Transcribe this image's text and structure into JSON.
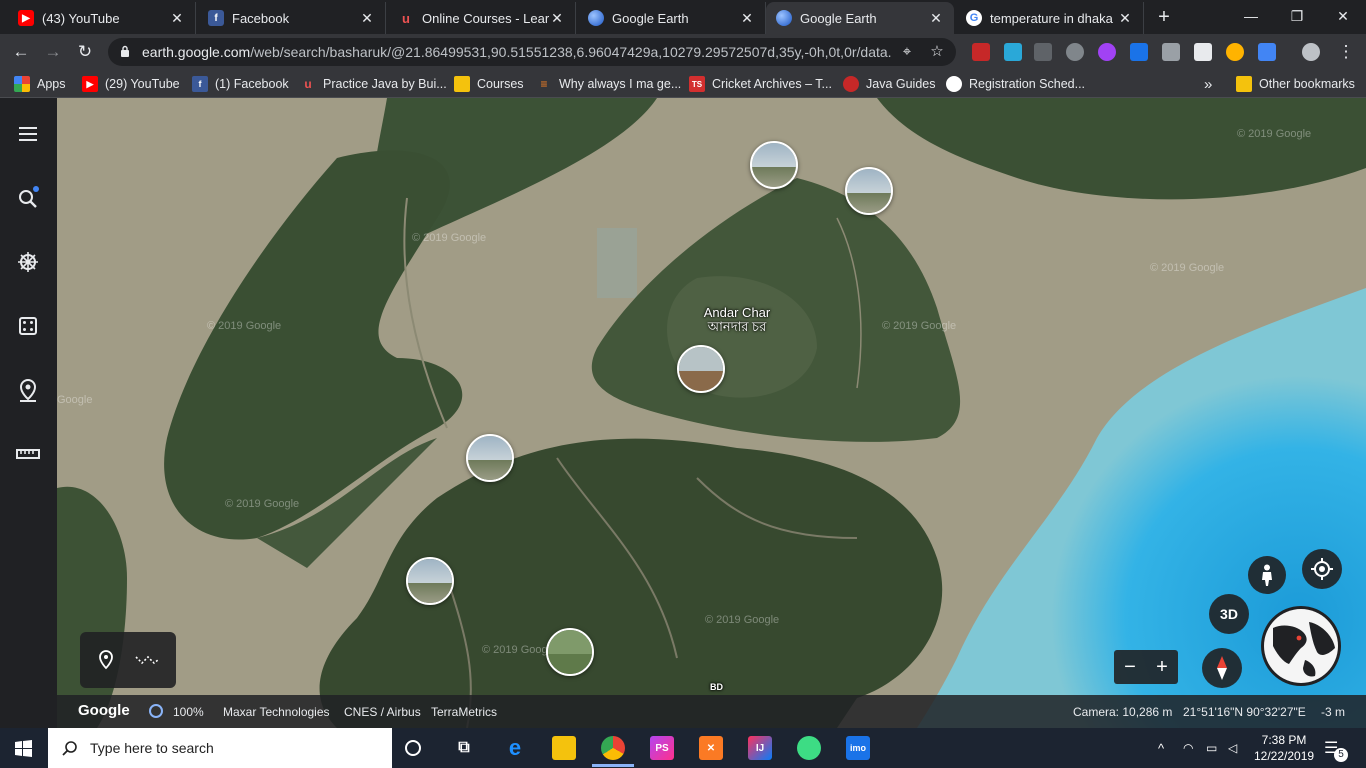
{
  "browser": {
    "tabs": [
      {
        "label": "(43) YouTube",
        "icon": "youtube-icon",
        "color": "#ff0000"
      },
      {
        "label": "Facebook",
        "icon": "facebook-icon",
        "color": "#3b5998"
      },
      {
        "label": "Online Courses - Learn",
        "icon": "udemy-icon",
        "color": "#ec5252"
      },
      {
        "label": "Google Earth",
        "icon": "google-earth-icon",
        "color": "#4a86e8"
      },
      {
        "label": "Google Earth",
        "icon": "google-earth-icon",
        "color": "#4a86e8"
      },
      {
        "label": "temperature in dhaka -",
        "icon": "google-icon",
        "color": "#4285f4"
      }
    ],
    "active_tab_index": 4,
    "url_host": "earth.google.com",
    "url_path": "/web/search/basharuk/@21.86499531,90.51551238,6.96047429a,10279.29572507d,35y,-0h,0t,0r/data...",
    "bookmarks": [
      {
        "label": "Apps",
        "icon": "apps-grid-icon",
        "color": "#ea4335"
      },
      {
        "label": "(29) YouTube",
        "icon": "youtube-icon",
        "color": "#ff0000"
      },
      {
        "label": "(1) Facebook",
        "icon": "facebook-icon",
        "color": "#3b5998"
      },
      {
        "label": "Practice Java by Bui...",
        "icon": "udemy-icon",
        "color": "#ec5252"
      },
      {
        "label": "Courses",
        "icon": "folder-icon",
        "color": "#f4c20d"
      },
      {
        "label": "Why always I ma ge...",
        "icon": "stackoverflow-icon",
        "color": "#f48024"
      },
      {
        "label": "Cricket Archives – T...",
        "icon": "ts-icon",
        "color": "#d32f2f"
      },
      {
        "label": "Java Guides",
        "icon": "java-guides-icon",
        "color": "#c62828"
      },
      {
        "label": "Registration Sched...",
        "icon": "globe-icon",
        "color": "#ffffff"
      }
    ],
    "bookmarks_overflow": "»",
    "other_bookmarks": "Other bookmarks"
  },
  "earth": {
    "place_label_en": "Andar Char",
    "place_label_bn": "আনদার চর",
    "country_label": "BD",
    "watermark": "© 2019 Google",
    "watermark_short": "Google",
    "button_3d": "3D",
    "zoom_out": "−",
    "zoom_in": "+",
    "status": {
      "logo": "Google",
      "load_percent": "100%",
      "attribution": [
        "Maxar Technologies",
        "CNES / Airbus",
        "TerraMetrics"
      ],
      "camera": "Camera: 10,286 m",
      "coords": "21°51'16\"N 90°32'27\"E",
      "elevation": "-3 m"
    }
  },
  "taskbar": {
    "search_placeholder": "Type here to search",
    "time": "7:38 PM",
    "date": "12/22/2019",
    "notification_count": "5",
    "apps": [
      {
        "name": "task-view-icon"
      },
      {
        "name": "action-center-apps-icon"
      },
      {
        "name": "edge-icon",
        "color": "#1e90ff"
      },
      {
        "name": "file-explorer-icon",
        "color": "#f4c20d"
      },
      {
        "name": "chrome-icon",
        "color": "#4285f4"
      },
      {
        "name": "phpstorm-icon",
        "color": "#b345f1"
      },
      {
        "name": "xampp-icon",
        "color": "#fb7a24"
      },
      {
        "name": "intellij-icon",
        "color": "#fe315d"
      },
      {
        "name": "android-studio-icon",
        "color": "#3ddc84"
      },
      {
        "name": "imo-icon",
        "color": "#1a73e8"
      }
    ],
    "imo_label": "imo",
    "ps_label": "PS",
    "ij_label": "IJ"
  }
}
